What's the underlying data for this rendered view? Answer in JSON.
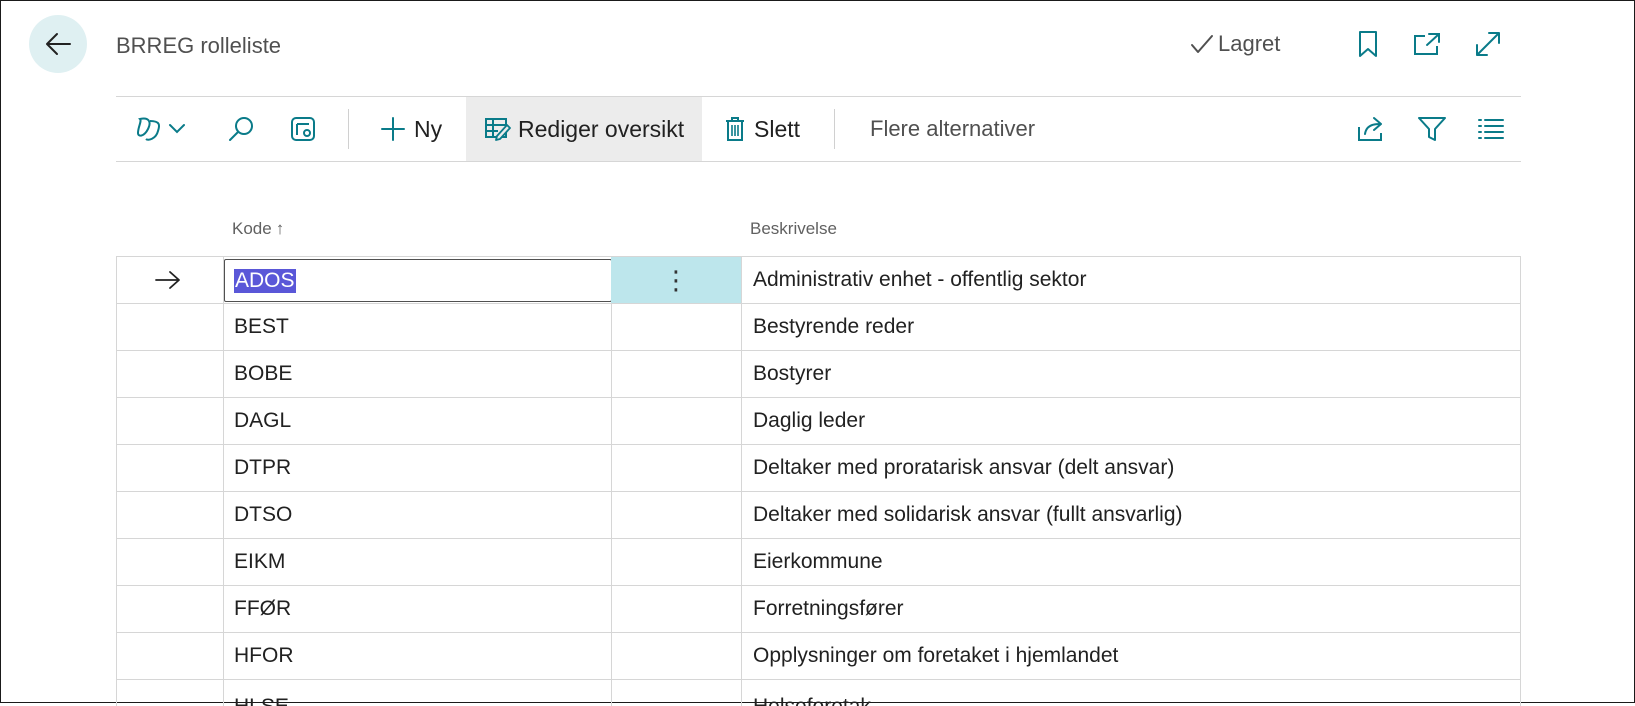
{
  "header": {
    "title": "BRREG rolleliste",
    "saved_label": "Lagret"
  },
  "actionbar": {
    "new_label": "Ny",
    "edit_list_label": "Rediger oversikt",
    "delete_label": "Slett",
    "more_options_label": "Flere alternativer"
  },
  "grid": {
    "columns": {
      "code": "Kode",
      "sort_indicator": "↑",
      "description": "Beskrivelse"
    },
    "selected_row_index": 0,
    "rows": [
      {
        "code": "ADOS",
        "description": "Administrativ enhet - offentlig sektor"
      },
      {
        "code": "BEST",
        "description": "Bestyrende reder"
      },
      {
        "code": "BOBE",
        "description": "Bostyrer"
      },
      {
        "code": "DAGL",
        "description": "Daglig leder"
      },
      {
        "code": "DTPR",
        "description": "Deltaker med proratarisk ansvar (delt ansvar)"
      },
      {
        "code": "DTSO",
        "description": "Deltaker med solidarisk ansvar (fullt ansvarlig)"
      },
      {
        "code": "EIKM",
        "description": "Eierkommune"
      },
      {
        "code": "FFØR",
        "description": "Forretningsfører"
      },
      {
        "code": "HFOR",
        "description": "Opplysninger om foretaket i hjemlandet"
      },
      {
        "code": "HLSE",
        "description": "Helseforetak"
      }
    ]
  },
  "colors": {
    "accent": "#0a7b89",
    "back_button_bg": "#dff0f2",
    "selected_cell_bg": "#bde6ec",
    "text_selection_bg": "#5a57d8"
  },
  "icons": [
    "back-arrow-icon",
    "checkmark-icon",
    "bookmark-icon",
    "open-in-new-window-icon",
    "expand-icon",
    "copilot-icon",
    "chevron-down-icon",
    "search-icon",
    "filter-pane-icon",
    "plus-icon",
    "edit-table-icon",
    "trash-icon",
    "share-icon",
    "filter-icon",
    "list-view-icon",
    "row-pointer-arrow-icon",
    "more-options-dots-icon"
  ]
}
